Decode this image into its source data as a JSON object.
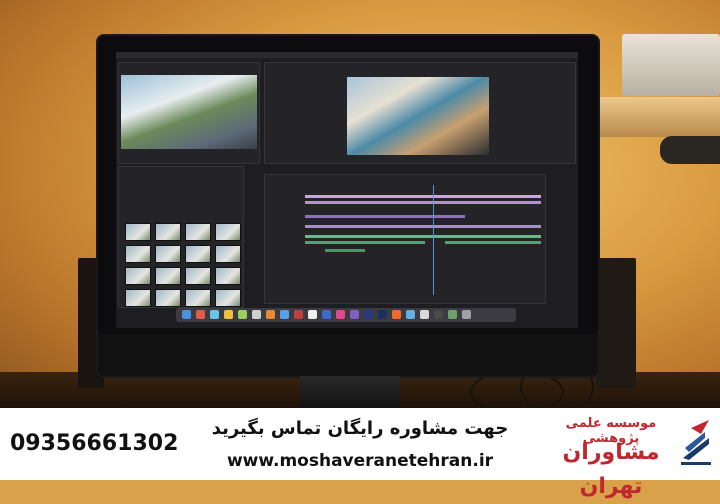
{
  "banner": {
    "phone": "09356661302",
    "cta": "جهت مشاوره رایگان تماس بگیرید",
    "url": "www.moshaveranetehran.ir",
    "org_subtitle": "موسسه علمی پژوهشی",
    "org_name": "مشاوران تهران"
  },
  "colors": {
    "accent_red": "#c0282f",
    "banner_bg": "#ffffff",
    "text": "#111111"
  },
  "icons": [
    "logo-icon"
  ]
}
